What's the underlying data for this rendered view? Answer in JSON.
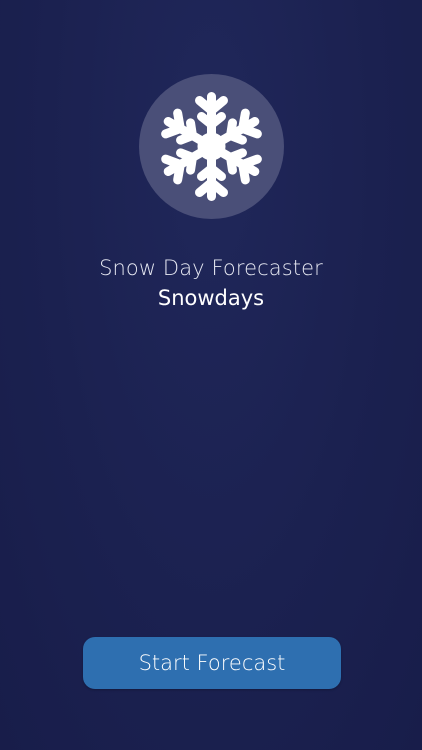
{
  "app": {
    "subtitle": "Snow Day Forecaster",
    "title": "Snowdays"
  },
  "logo": {
    "icon": "snowflake-icon"
  },
  "actions": {
    "start_label": "Start Forecast"
  },
  "colors": {
    "background": "#1b2150",
    "logo_circle": "#4a4f78",
    "button": "#2e6fb0",
    "text": "#ffffff"
  }
}
